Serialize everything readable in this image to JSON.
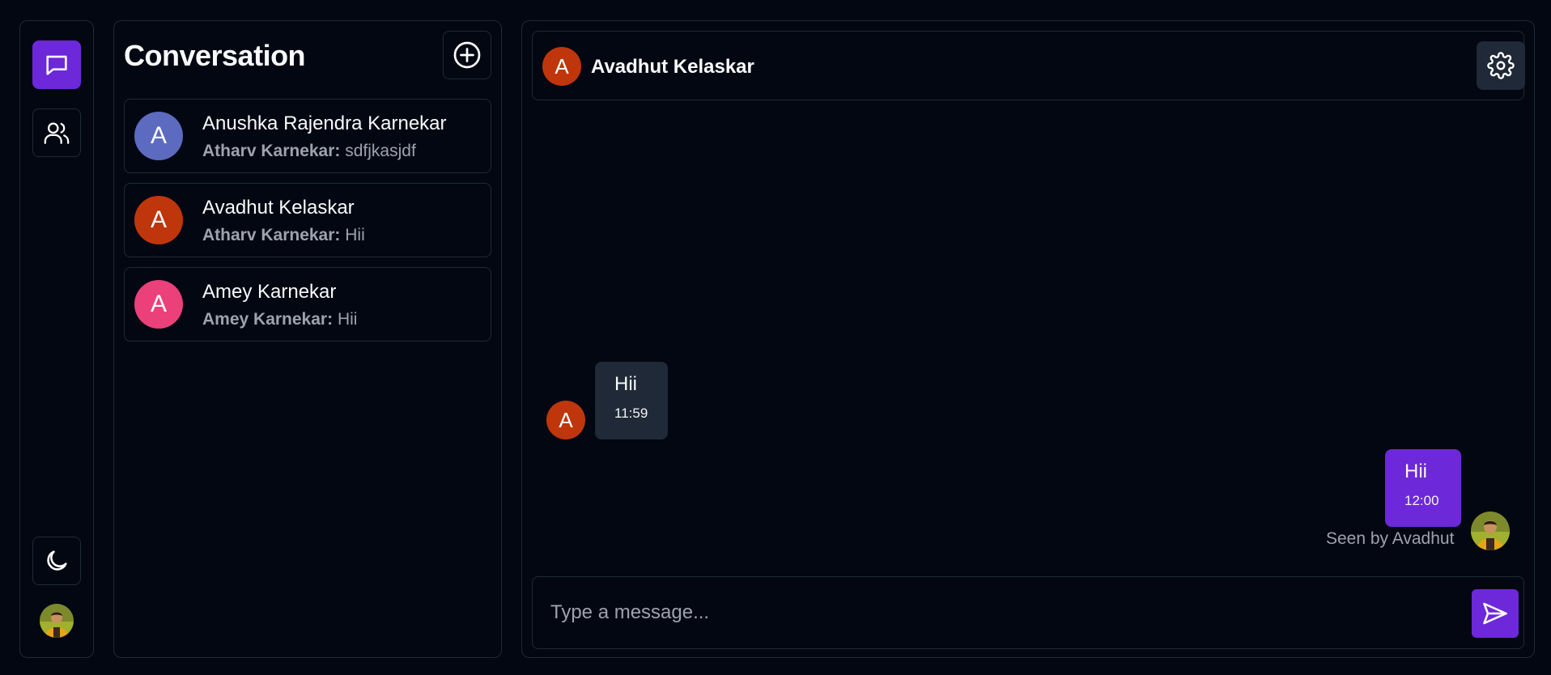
{
  "colors": {
    "background": "#030712",
    "border": "#1f2937",
    "accent": "#6d28d9",
    "incoming_bubble": "#1f2937",
    "muted_text": "#9ca3af"
  },
  "rail": {
    "items": [
      {
        "icon": "chat-bubble-icon",
        "active": true
      },
      {
        "icon": "users-icon",
        "active": false
      },
      {
        "icon": "moon-icon",
        "active": false
      }
    ],
    "profile_avatar": "user-photo-avatar"
  },
  "conversations": {
    "title": "Conversation",
    "new_icon": "plus-circle-icon",
    "items": [
      {
        "initial": "A",
        "avatar_color": "#5c6bc0",
        "name": "Anushka Rajendra Karnekar",
        "last_sender": "Atharv Karnekar:",
        "last_message": "sdfjkasjdf"
      },
      {
        "initial": "A",
        "avatar_color": "#bf360c",
        "name": "Avadhut Kelaskar",
        "last_sender": "Atharv Karnekar:",
        "last_message": "Hii"
      },
      {
        "initial": "A",
        "avatar_color": "#ec407a",
        "name": "Amey Karnekar",
        "last_sender": "Amey Karnekar:",
        "last_message": "Hii"
      }
    ]
  },
  "chat": {
    "header": {
      "initial": "A",
      "avatar_color": "#bf360c",
      "title": "Avadhut Kelaskar",
      "settings_icon": "gear-icon"
    },
    "messages": [
      {
        "direction": "incoming",
        "sender_initial": "A",
        "text": "Hii",
        "time": "11:59"
      },
      {
        "direction": "outgoing",
        "text": "Hii",
        "time": "12:00",
        "status": "Seen by Avadhut"
      }
    ],
    "composer": {
      "placeholder": "Type a message...",
      "value": "",
      "send_icon": "send-icon"
    }
  }
}
